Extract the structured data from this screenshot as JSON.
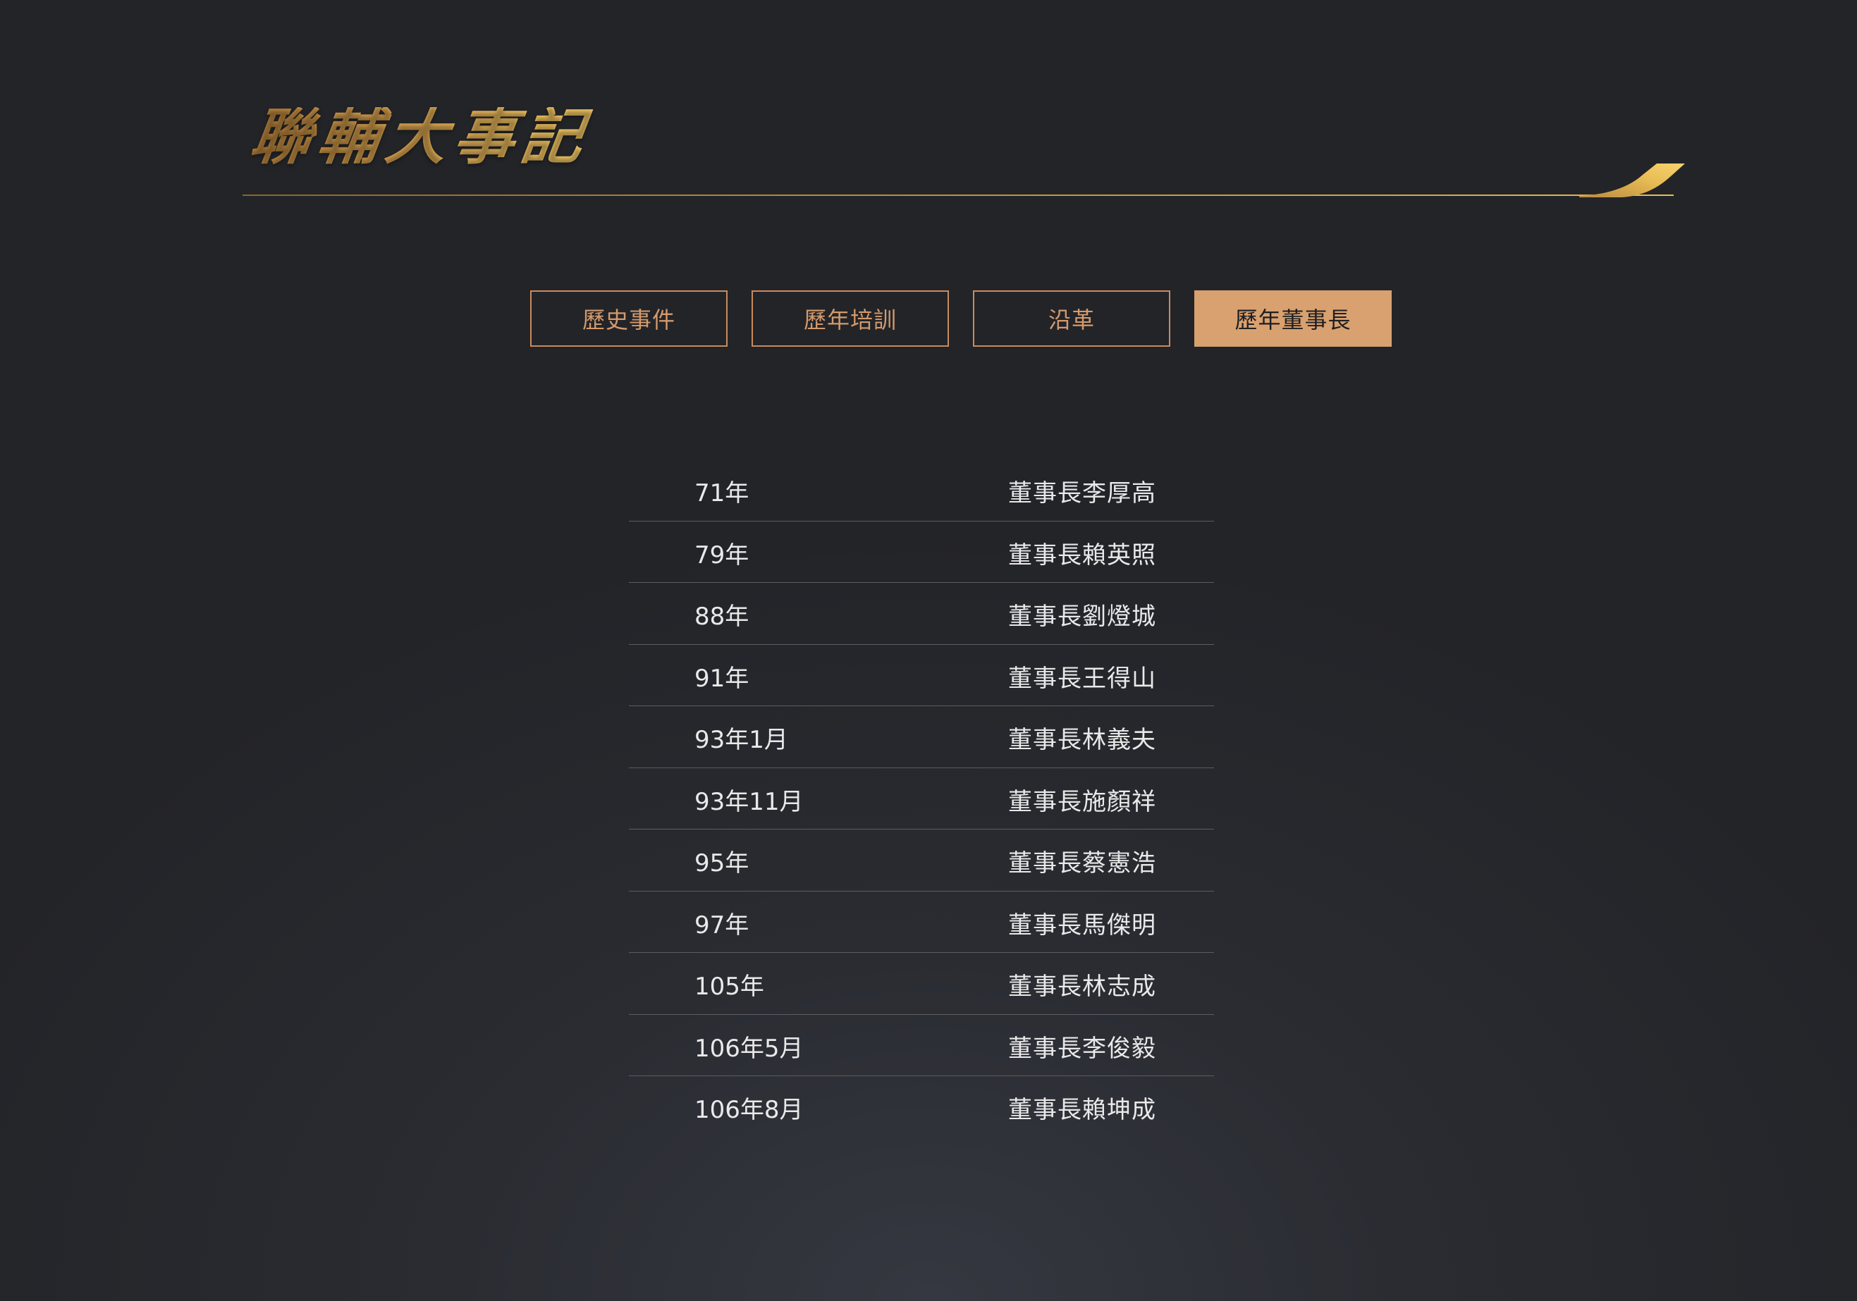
{
  "title": "聯輔大事記",
  "tabs": [
    {
      "label": "歷史事件",
      "active": false
    },
    {
      "label": "歷年培訓",
      "active": false
    },
    {
      "label": "沿革",
      "active": false
    },
    {
      "label": "歷年董事長",
      "active": true
    }
  ],
  "chairmen": [
    {
      "year": "71年",
      "name": "董事長李厚高"
    },
    {
      "year": "79年",
      "name": "董事長賴英照"
    },
    {
      "year": "88年",
      "name": "董事長劉燈城"
    },
    {
      "year": "91年",
      "name": "董事長王得山"
    },
    {
      "year": "93年1月",
      "name": "董事長林義夫"
    },
    {
      "year": "93年11月",
      "name": "董事長施顏祥"
    },
    {
      "year": "95年",
      "name": "董事長蔡憲浩"
    },
    {
      "year": "97年",
      "name": "董事長馬傑明"
    },
    {
      "year": "105年",
      "name": "董事長林志成"
    },
    {
      "year": "106年5月",
      "name": "董事長李俊毅"
    },
    {
      "year": "106年8月",
      "name": "董事長賴坤成"
    }
  ],
  "colors": {
    "background": "#2a2c32",
    "gold": "#d9a24f",
    "tab_border": "#c88b5e",
    "tab_active_bg": "#d9a16f",
    "row_divider": "#5b5d63",
    "text": "#e9e9ea"
  }
}
